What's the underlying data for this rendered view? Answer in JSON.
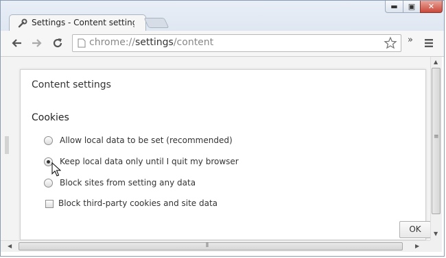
{
  "window": {
    "controls": {
      "minimize": "▬",
      "maximize": "▣",
      "close": "✕"
    }
  },
  "tab": {
    "title": "Settings - Content settings",
    "icon": "wrench-icon"
  },
  "toolbar": {
    "back_icon": "back-arrow-icon",
    "forward_icon": "forward-arrow-icon",
    "reload_icon": "reload-icon",
    "url_scheme": "chrome://",
    "url_host": "settings",
    "url_path": "/content",
    "bookmark_icon": "star-icon",
    "extensions_chevron": "»",
    "menu_icon": "hamburger-menu-icon"
  },
  "dialog": {
    "title": "Content settings",
    "section": "Cookies",
    "options": [
      {
        "label": "Allow local data to be set (recommended)",
        "type": "radio",
        "checked": false
      },
      {
        "label": "Keep local data only until I quit my browser",
        "type": "radio",
        "checked": true
      },
      {
        "label": "Block sites from setting any data",
        "type": "radio",
        "checked": false
      },
      {
        "label": "Block third-party cookies and site data",
        "type": "checkbox",
        "checked": false
      }
    ],
    "ok_label": "OK"
  },
  "colors": {
    "titlebar": "#dfe7f2",
    "close_button": "#c9483a",
    "toolbar": "#f6f6f6",
    "content_bg": "#f3f3f3"
  }
}
